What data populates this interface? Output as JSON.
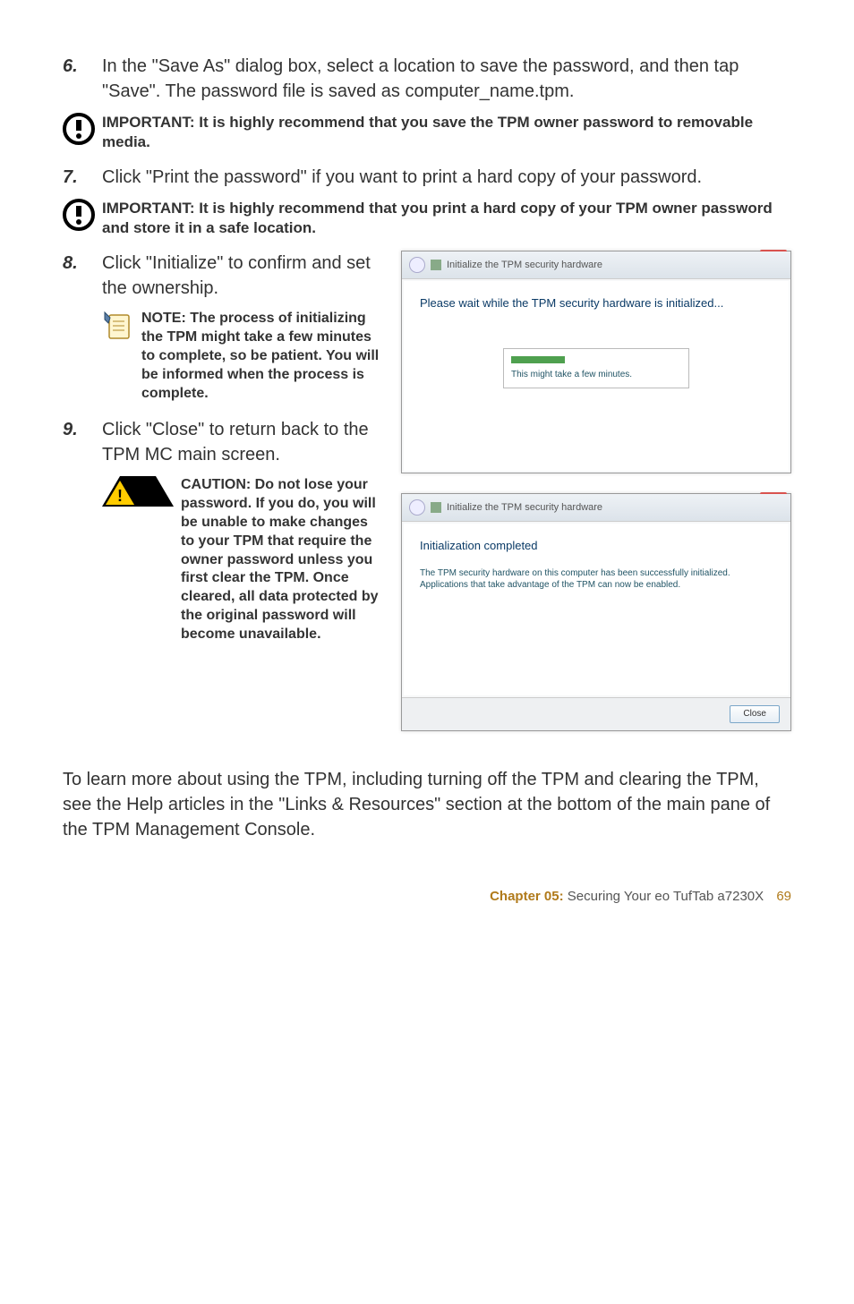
{
  "step6": {
    "num": "6.",
    "text": "In the \"Save As\" dialog box, select a location to save the password, and then tap \"Save\". The password file is saved as computer_name.tpm."
  },
  "important1": "IMPORTANT: It is highly recommend that you save the TPM owner password to removable media.",
  "step7": {
    "num": "7.",
    "text": "Click \"Print the password\" if you want to print a hard copy of your password."
  },
  "important2": "IMPORTANT: It is highly recommend that you print a hard copy of your TPM owner password and store it in a safe location.",
  "step8": {
    "num": "8.",
    "text": "Click \"Initialize\" to confirm and set the ownership."
  },
  "note1": "NOTE: The process of initializing the TPM might take a few minutes to complete, so be patient. You will be informed when the process is complete.",
  "step9": {
    "num": "9.",
    "text": "Click \"Close\" to return back to the TPM MC main screen."
  },
  "caution1": "CAUTION: Do not lose your password. If you do, you will be unable to make changes to your TPM that require the owner password unless you first clear the TPM. Once cleared, all data protected by the original password will become unavailable.",
  "dialog1": {
    "title": "Initialize the TPM security hardware",
    "heading": "Please wait while the TPM security hardware is initialized...",
    "progress": "This might take a few minutes."
  },
  "dialog2": {
    "title": "Initialize the TPM security hardware",
    "heading": "Initialization completed",
    "body": "The TPM security hardware on this computer has been successfully initialized. Applications that take advantage of the TPM can now be enabled.",
    "close": "Close"
  },
  "para": "To learn more about using the TPM, including turning off the TPM and clearing the TPM, see the Help articles in the \"Links & Resources\" section at the bottom of the main pane of the TPM Management Console.",
  "footer": {
    "chapter": "Chapter 05:",
    "title": "Securing Your eo TufTab a7230X",
    "page": "69"
  }
}
